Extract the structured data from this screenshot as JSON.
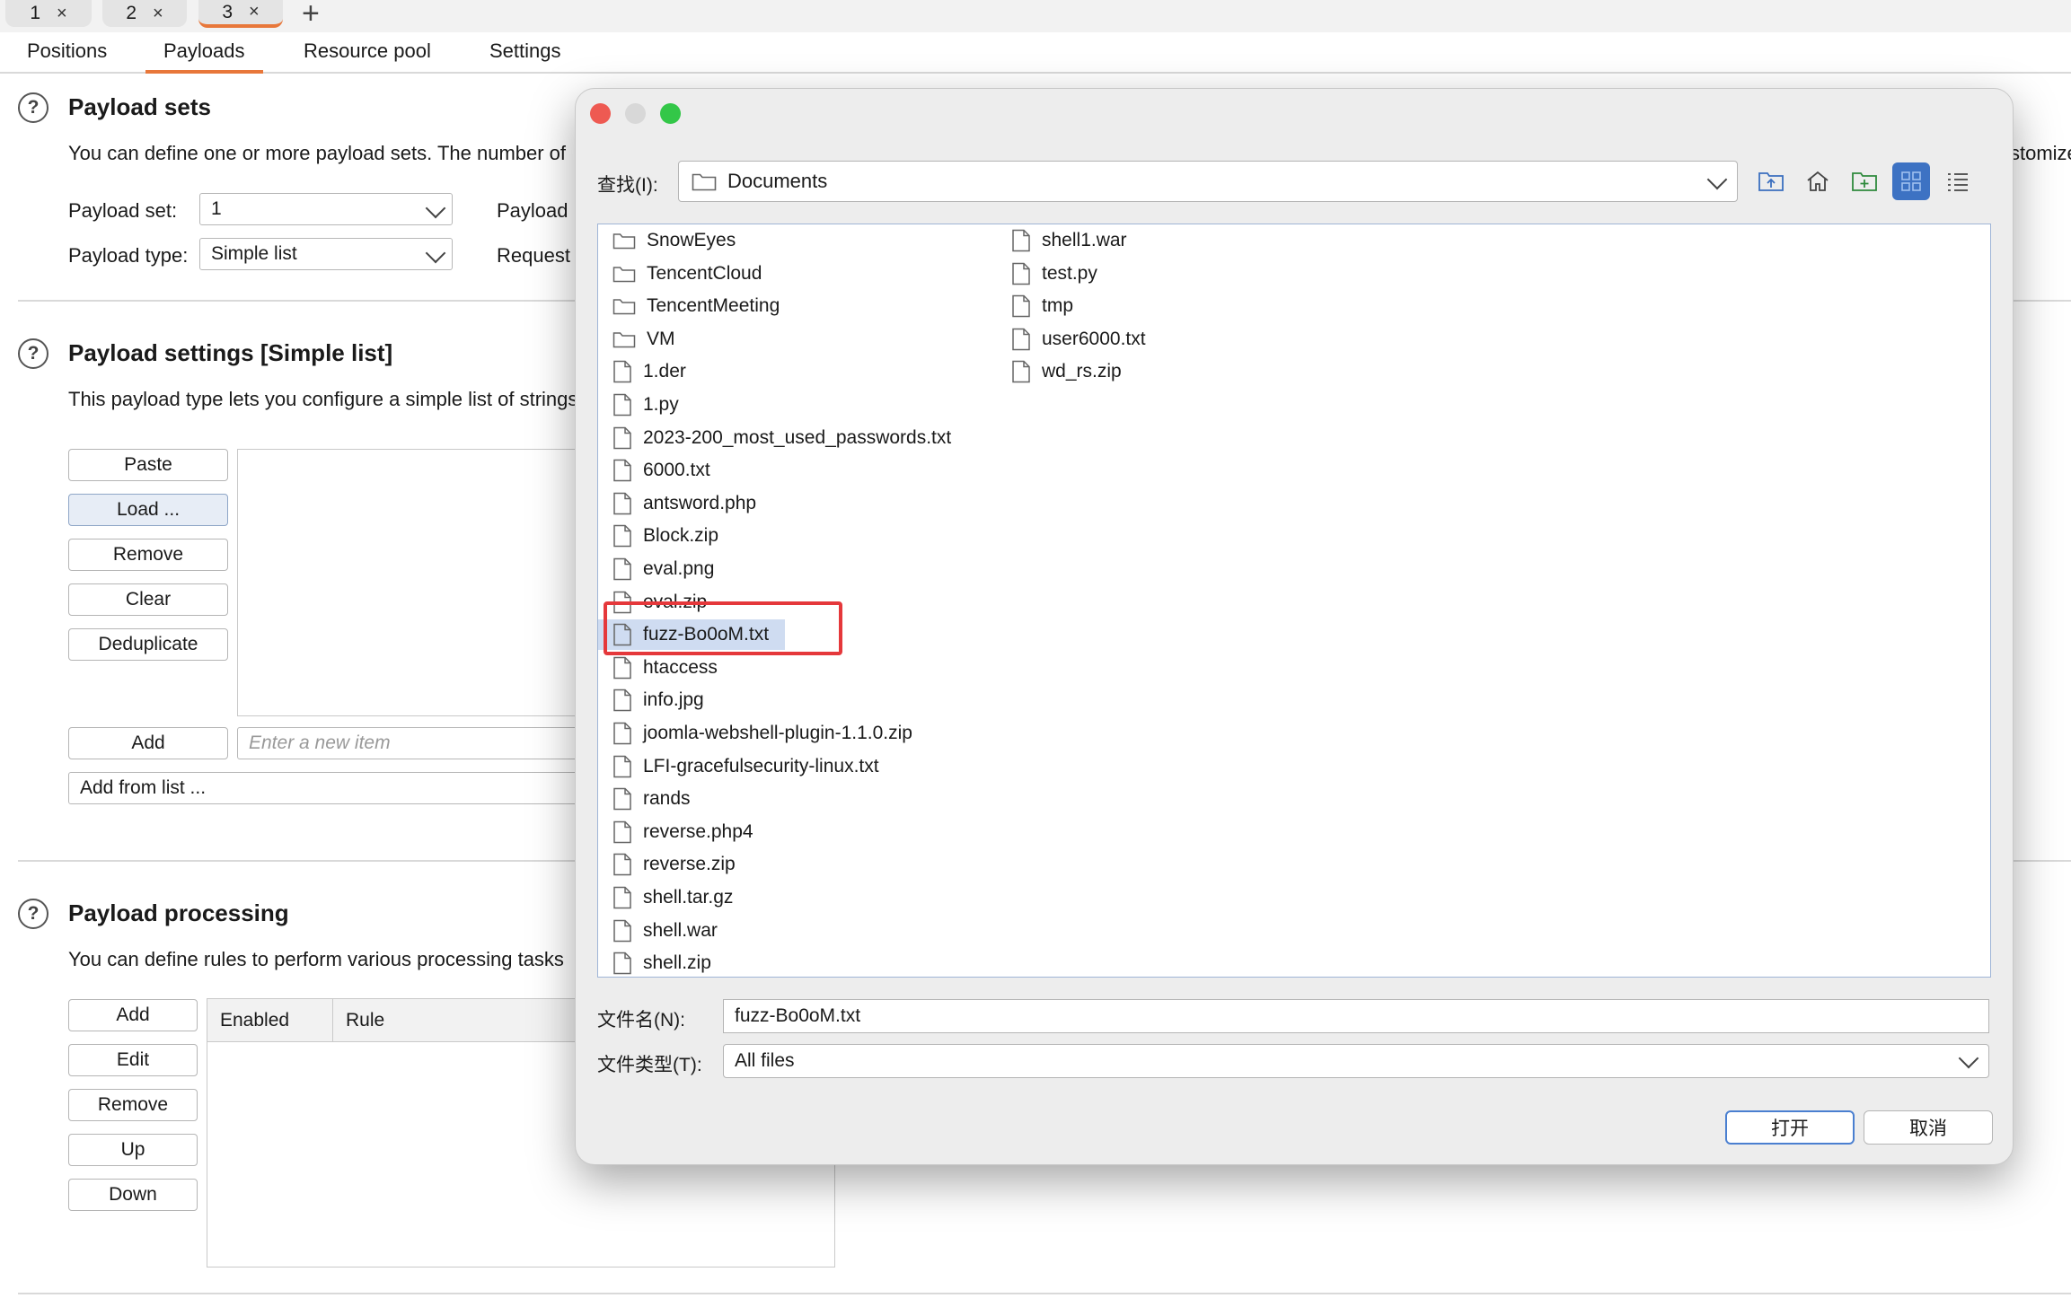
{
  "intruder_tabs": [
    {
      "label": "1",
      "close": "×"
    },
    {
      "label": "2",
      "close": "×"
    },
    {
      "label": "3",
      "close": "×"
    }
  ],
  "add_tab_glyph": "+",
  "sub_tabs": [
    "Positions",
    "Payloads",
    "Resource pool",
    "Settings"
  ],
  "payload_sets": {
    "title": "Payload sets",
    "description": "You can define one or more payload sets. The number of",
    "set_label": "Payload set:",
    "set_value": "1",
    "type_label": "Payload type:",
    "type_value": "Simple list",
    "right_label_1": "Payload",
    "right_label_2": "Request",
    "right_edge_text": "stomize"
  },
  "payload_settings": {
    "title": "Payload settings [Simple list]",
    "description": "This payload type lets you configure a simple list of strings",
    "buttons": [
      "Paste",
      "Load ...",
      "Remove",
      "Clear",
      "Deduplicate"
    ],
    "add_label": "Add",
    "new_item_placeholder": "Enter a new item",
    "add_from_list": "Add from list ..."
  },
  "payload_processing": {
    "title": "Payload processing",
    "description": "You can define rules to perform various processing tasks",
    "buttons": [
      "Add",
      "Edit",
      "Remove",
      "Up",
      "Down"
    ],
    "columns": [
      "Enabled",
      "Rule"
    ]
  },
  "help_glyph": "?",
  "dialog": {
    "look_in_label": "查找(I):",
    "look_in_value": "Documents",
    "files_col1": [
      "SnowEyes",
      "TencentCloud",
      "TencentMeeting",
      "VM",
      "1.der",
      "1.py",
      "2023-200_most_used_passwords.txt",
      "6000.txt",
      "antsword.php",
      "Block.zip",
      "eval.png",
      "eval.zip",
      "fuzz-Bo0oM.txt",
      "htaccess",
      "info.jpg",
      "joomla-webshell-plugin-1.1.0.zip",
      "LFI-gracefulsecurity-linux.txt",
      "rands",
      "reverse.php4",
      "reverse.zip",
      "shell.tar.gz",
      "shell.war",
      "shell.zip"
    ],
    "files_col2": [
      "shell1.war",
      "test.py",
      "tmp",
      "user6000.txt",
      "wd_rs.zip"
    ],
    "selected_file": "fuzz-Bo0oM.txt",
    "filename_label": "文件名(N):",
    "filename_value": "fuzz-Bo0oM.txt",
    "filetype_label": "文件类型(T):",
    "filetype_value": "All files",
    "open_button": "打开",
    "cancel_button": "取消",
    "colors": {
      "close": "#ee5a52",
      "minimize": "#d8d8d8",
      "zoom": "#33c748",
      "highlight": "#e5383b",
      "accent": "#3d72c3"
    }
  }
}
